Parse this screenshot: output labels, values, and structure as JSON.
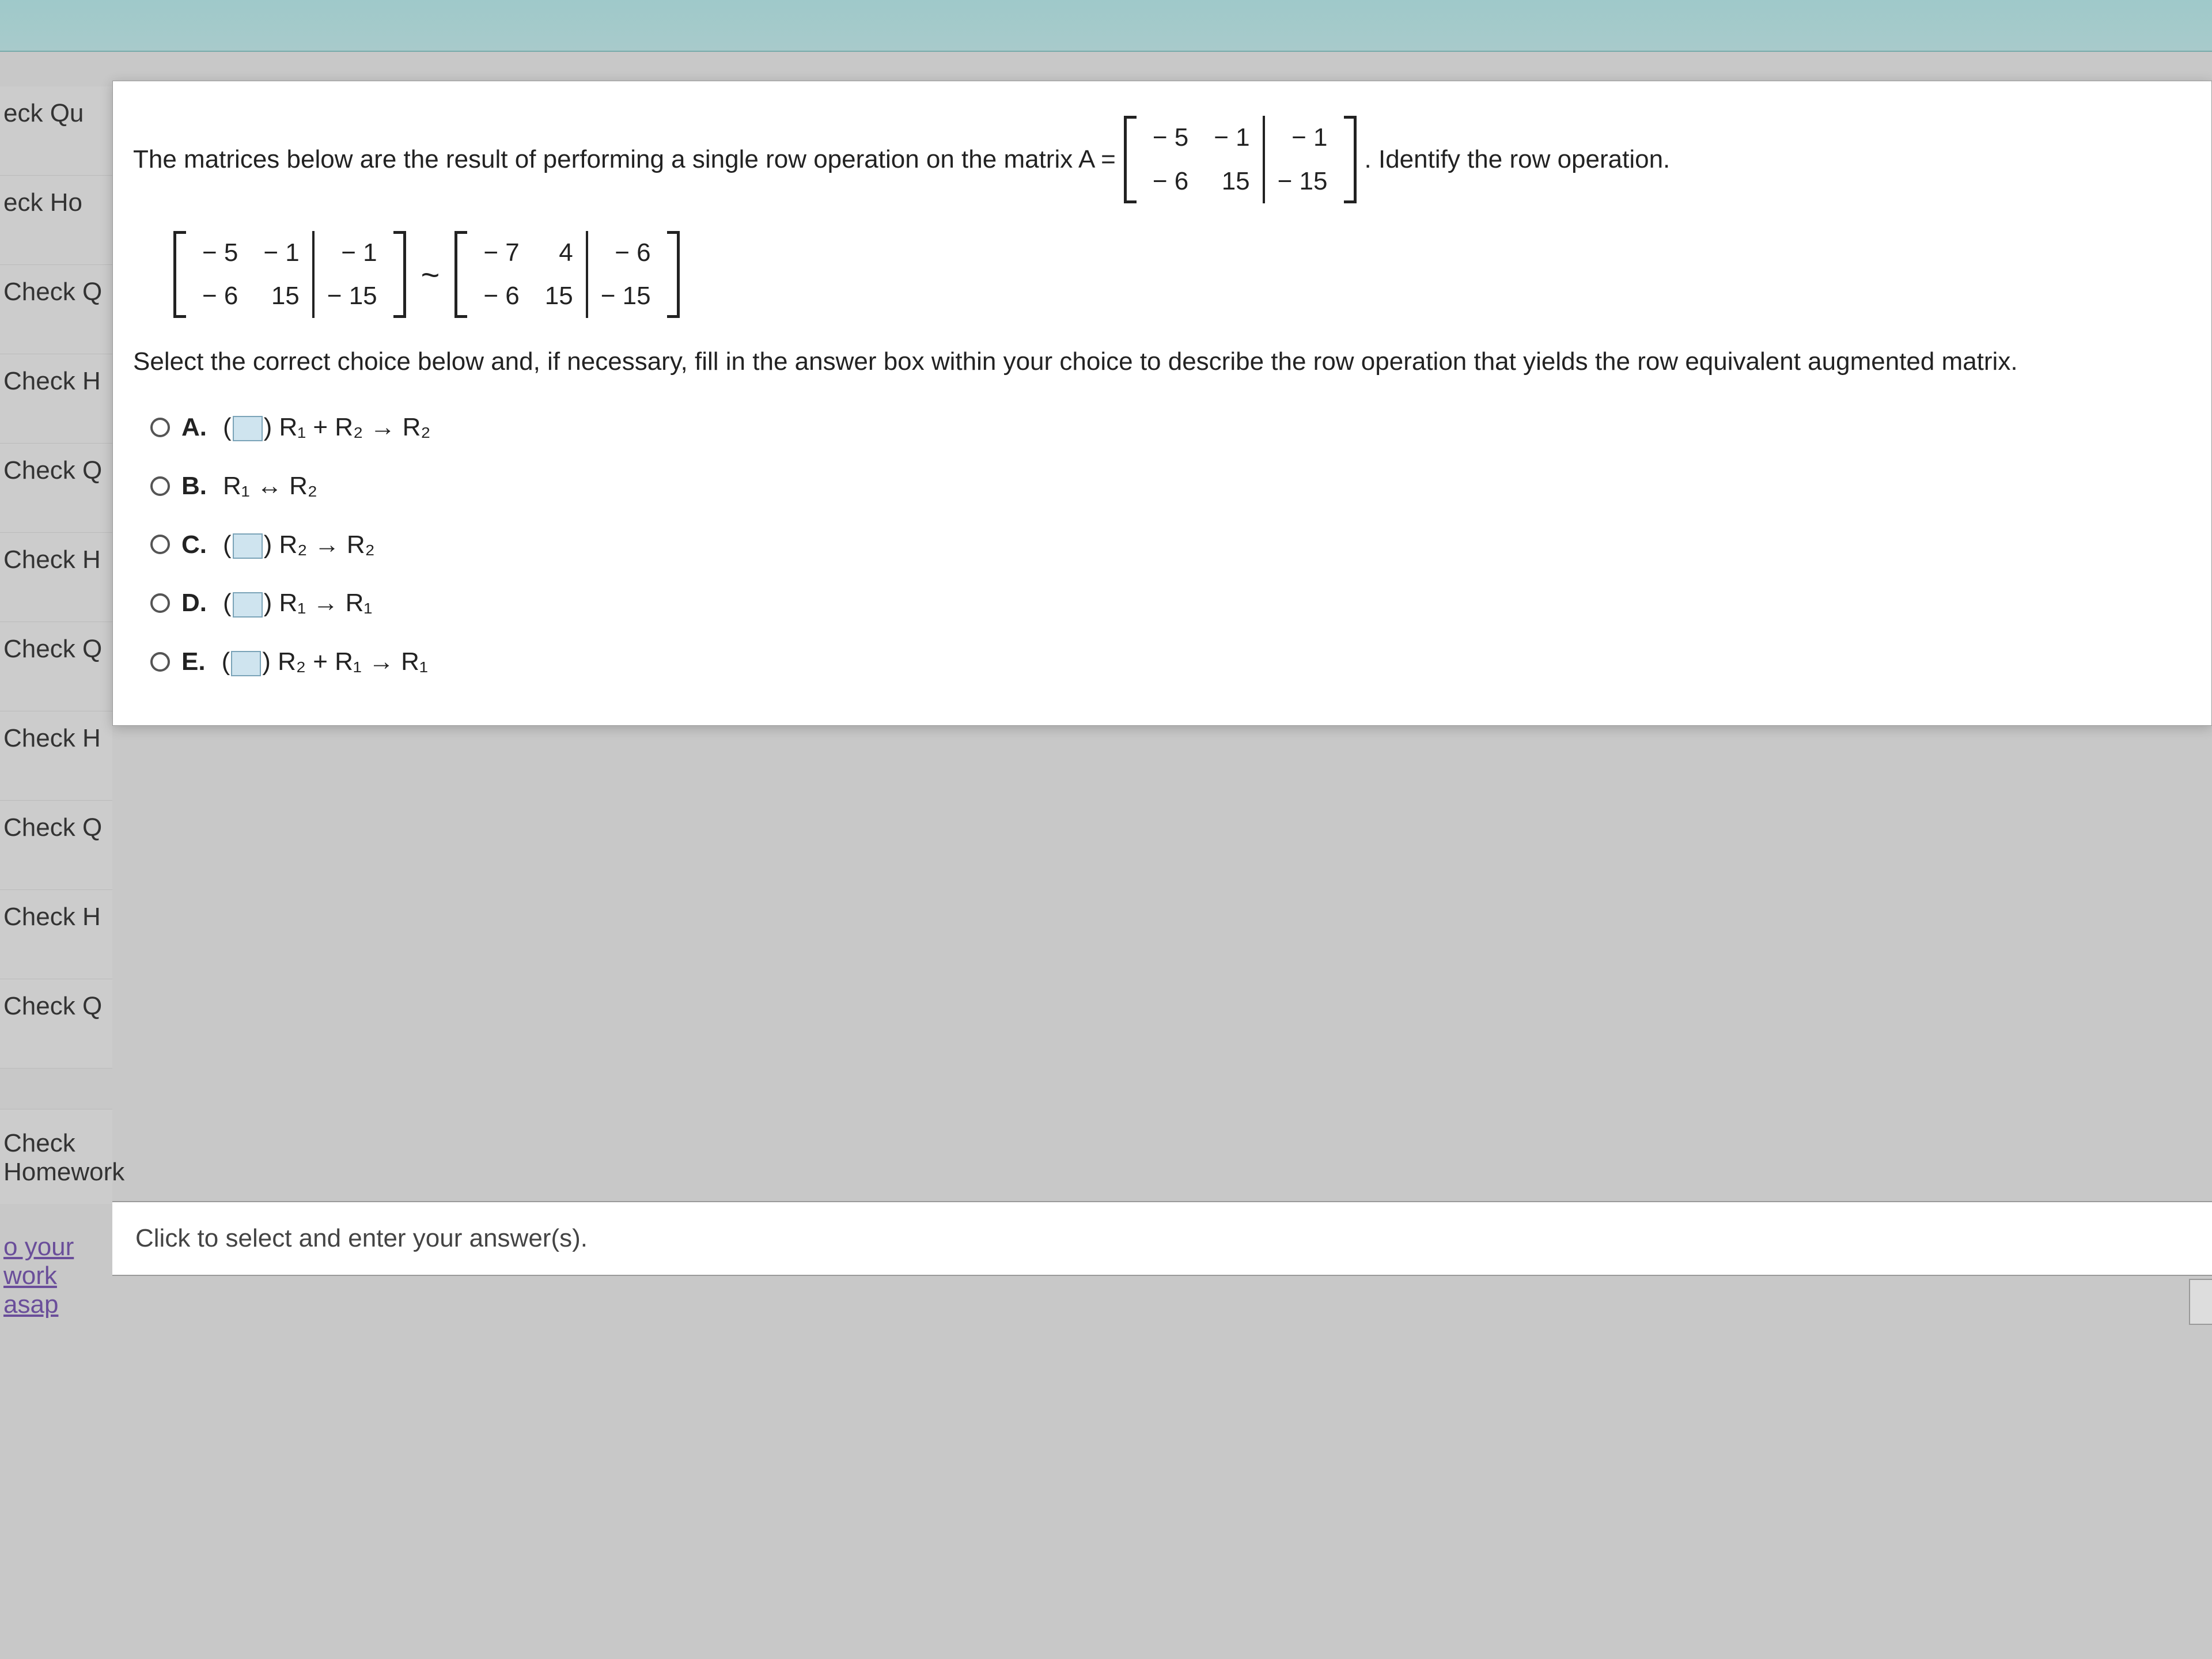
{
  "sidebar": {
    "items": [
      "eck Qu",
      "eck Ho",
      "Check Q",
      "Check H",
      "Check Q",
      "Check H",
      "Check Q",
      "Check H",
      "Check Q",
      "Check H",
      "Check Q"
    ],
    "homework": "Check Homework",
    "link": "o your work asap"
  },
  "question": {
    "intro_a": "The matrices below are the result of performing a single row operation on the matrix A =",
    "intro_b": ". Identify the row operation.",
    "matrix_A": {
      "r1": [
        "− 5",
        "− 1",
        "− 1"
      ],
      "r2": [
        "− 6",
        "15",
        "− 15"
      ]
    },
    "matrix_left": {
      "r1": [
        "− 5",
        "− 1",
        "− 1"
      ],
      "r2": [
        "− 6",
        "15",
        "− 15"
      ]
    },
    "matrix_right": {
      "r1": [
        "− 7",
        "4",
        "− 6"
      ],
      "r2": [
        "− 6",
        "15",
        "− 15"
      ]
    },
    "tilde": "~",
    "instruction": "Select the correct choice below and, if necessary, fill in the answer box within your choice to describe the row operation that yields the row equivalent augmented matrix.",
    "choices": {
      "A": {
        "letter": "A.",
        "pre": "(",
        "post": ") R₁ + R₂ → R₂",
        "has_box": true
      },
      "B": {
        "letter": "B.",
        "text": "R₁ ↔ R₂",
        "has_box": false
      },
      "C": {
        "letter": "C.",
        "pre": "(",
        "post": ") R₂ → R₂",
        "has_box": true
      },
      "D": {
        "letter": "D.",
        "pre": "(",
        "post": ") R₁ → R₁",
        "has_box": true
      },
      "E": {
        "letter": "E.",
        "pre": "(",
        "post": ") R₂ + R₁ → R₁",
        "has_box": true
      }
    }
  },
  "footer_prompt": "Click to select and enter your answer(s)."
}
